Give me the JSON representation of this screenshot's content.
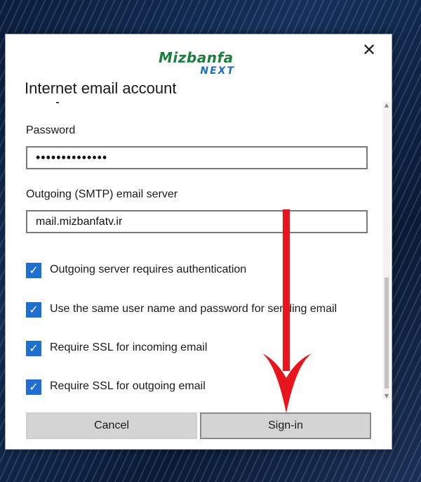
{
  "dialog": {
    "logo": {
      "top": "Mizbanfa",
      "bottom": "NEXT"
    },
    "title": "Internet email account",
    "close_icon": "close-icon",
    "password": {
      "label": "Password",
      "value": "••••••••••••••"
    },
    "smtp": {
      "label": "Outgoing (SMTP) email server",
      "value": "mail.mizbanfatv.ir"
    },
    "checkboxes": [
      {
        "label": "Outgoing server requires authentication",
        "checked": true
      },
      {
        "label": "Use the same user name and password for sending email",
        "checked": true
      },
      {
        "label": "Require SSL for incoming email",
        "checked": true
      },
      {
        "label": "Require SSL for outgoing email",
        "checked": true
      }
    ],
    "buttons": {
      "cancel": "Cancel",
      "signin": "Sign-in"
    }
  },
  "colors": {
    "accent": "#1f6fd0",
    "annotation_arrow": "#e8151c",
    "logo_green": "#1a7f3c",
    "logo_blue": "#1d6fbf"
  }
}
